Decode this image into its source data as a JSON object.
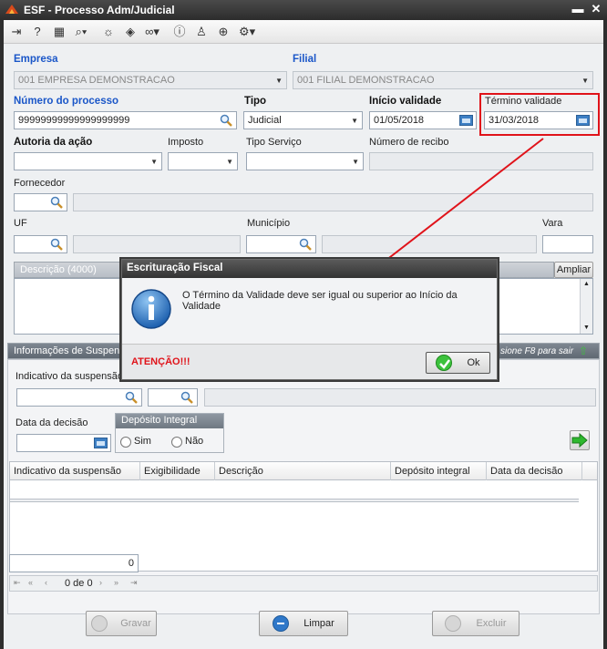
{
  "window": {
    "title": "ESF - Processo Adm/Judicial"
  },
  "toolbar": {
    "icons": [
      "exit-icon",
      "help-icon",
      "keyboard-icon",
      "search-icon",
      "lightbulb-icon",
      "map-icon",
      "link-icon",
      "info-icon",
      "user-icon",
      "add-document-icon",
      "settings-icon"
    ]
  },
  "form": {
    "empresa": {
      "label": "Empresa",
      "value": "001 EMPRESA DEMONSTRACAO"
    },
    "filial": {
      "label": "Filial",
      "value": "001 FILIAL DEMONSTRACAO"
    },
    "numero_processo": {
      "label": "Número do processo",
      "value": "99999999999999999999"
    },
    "tipo": {
      "label": "Tipo",
      "value": "Judicial"
    },
    "inicio_validade": {
      "label": "Início validade",
      "value": "01/05/2018"
    },
    "termino_validade": {
      "label": "Término validade",
      "value": "31/03/2018"
    },
    "autoria_acao": {
      "label": "Autoria da ação",
      "value": ""
    },
    "imposto": {
      "label": "Imposto",
      "value": ""
    },
    "tipo_servico": {
      "label": "Tipo Serviço",
      "value": ""
    },
    "numero_recibo": {
      "label": "Número de recibo",
      "value": ""
    },
    "fornecedor": {
      "label": "Fornecedor"
    },
    "uf": {
      "label": "UF"
    },
    "municipio": {
      "label": "Município"
    },
    "vara": {
      "label": "Vara"
    },
    "descricao": {
      "label": "Descrição (4000)",
      "ampliar": "Ampliar"
    }
  },
  "suspensao": {
    "header": "Informações de Suspens",
    "hint": "sione F8 para sair",
    "indicativo_label": "Indicativo da suspensão",
    "data_decisao_label": "Data da decisão",
    "deposito_integral": {
      "title": "Depósito Integral",
      "sim": "Sim",
      "nao": "Não"
    },
    "grid": {
      "columns": [
        "Indicativo da suspensão",
        "Exigibilidade",
        "Descrição",
        "Depósito integral",
        "Data da decisão"
      ],
      "footer_value": "0",
      "pagination": "0 de 0"
    }
  },
  "buttons": {
    "gravar": "Gravar",
    "limpar": "Limpar",
    "excluir": "Excluir"
  },
  "dialog": {
    "title": "Escrituração Fiscal",
    "message": "O Término da Validade deve ser igual ou superior ao Início da Validade",
    "warning": "ATENÇÃO!!!",
    "ok": "Ok"
  },
  "colors": {
    "label_blue": "#1a56c8",
    "highlight_red": "#e0131a",
    "warning_red": "#e0131a"
  }
}
